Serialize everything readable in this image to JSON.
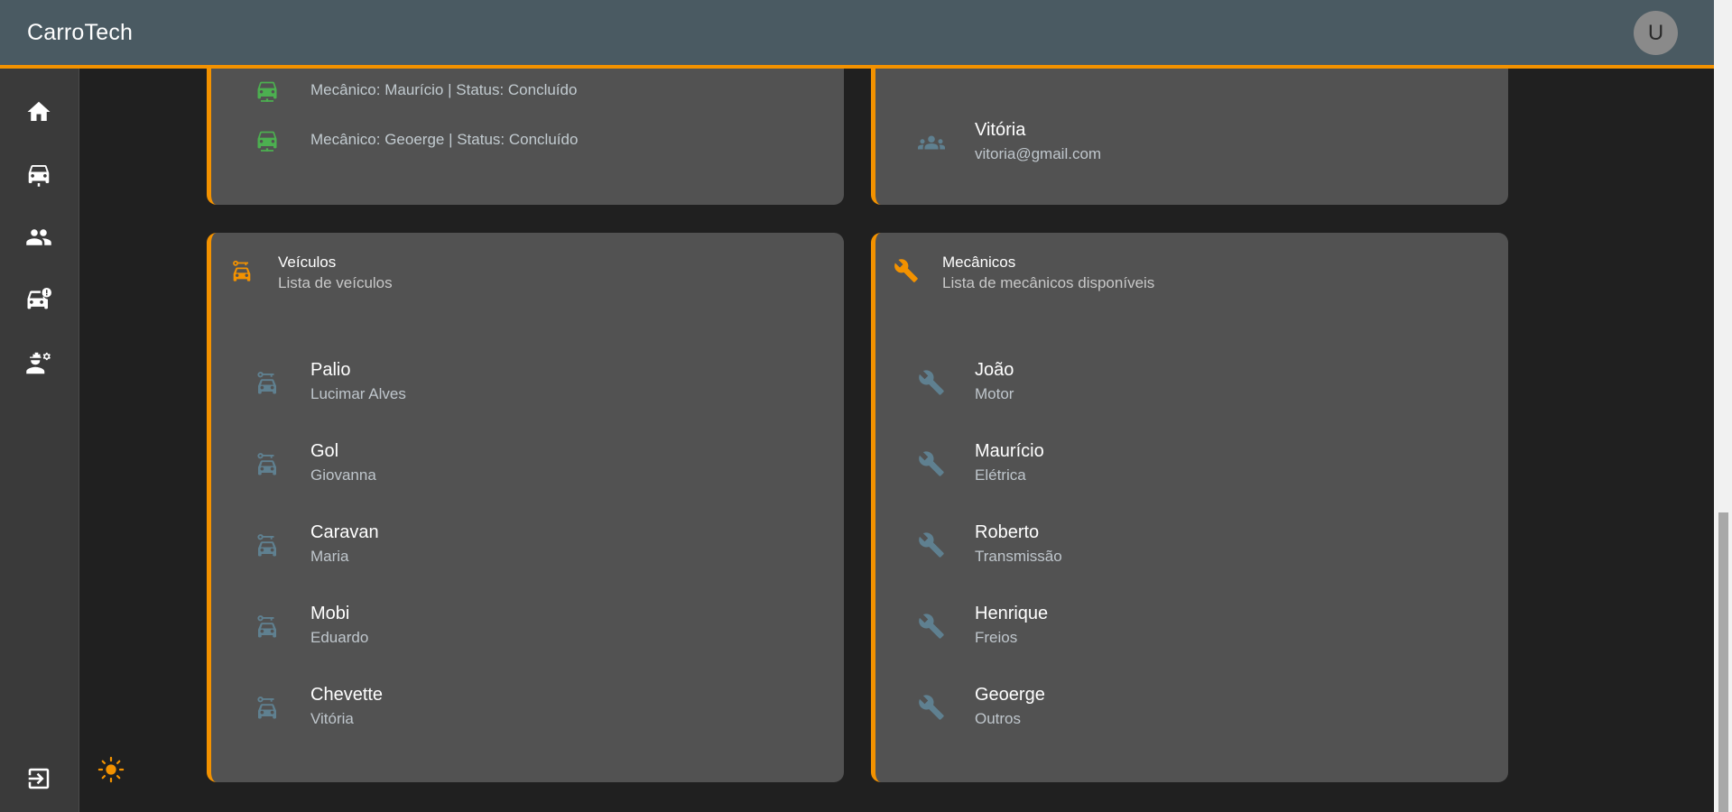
{
  "app": {
    "title": "CarroTech",
    "avatar_letter": "U",
    "accent": "#f39200"
  },
  "sidebar": {
    "items": [
      {
        "icon": "home-icon"
      },
      {
        "icon": "car-icon"
      },
      {
        "icon": "people-icon"
      },
      {
        "icon": "car-alert-icon"
      },
      {
        "icon": "engineer-icon"
      }
    ],
    "logout_icon": "logout-icon",
    "theme_icon": "sun-icon"
  },
  "ordens": {
    "items": [
      {
        "text": "Mecânico: Maurício | Status: Concluído"
      },
      {
        "text": "Mecânico: Geoerge | Status: Concluído"
      }
    ]
  },
  "clientes": {
    "items": [
      {
        "name": "Vitória",
        "email": "vitoria@gmail.com"
      }
    ]
  },
  "veiculos": {
    "title": "Veículos",
    "subtitle": "Lista de veículos",
    "items": [
      {
        "model": "Palio",
        "owner": "Lucimar Alves"
      },
      {
        "model": "Gol",
        "owner": "Giovanna"
      },
      {
        "model": "Caravan",
        "owner": "Maria"
      },
      {
        "model": "Mobi",
        "owner": "Eduardo"
      },
      {
        "model": "Chevette",
        "owner": "Vitória"
      }
    ]
  },
  "mecanicos": {
    "title": "Mecânicos",
    "subtitle": "Lista de mecânicos disponíveis",
    "items": [
      {
        "name": "João",
        "specialty": "Motor"
      },
      {
        "name": "Maurício",
        "specialty": "Elétrica"
      },
      {
        "name": "Roberto",
        "specialty": "Transmissão"
      },
      {
        "name": "Henrique",
        "specialty": "Freios"
      },
      {
        "name": "Geoerge",
        "specialty": "Outros"
      }
    ]
  }
}
